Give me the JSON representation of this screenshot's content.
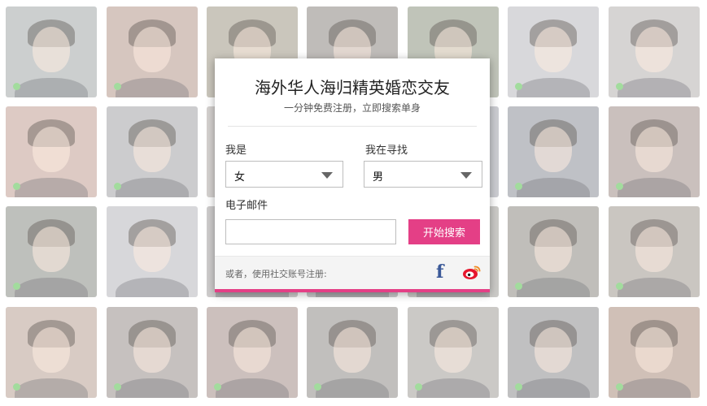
{
  "colors": {
    "accent": "#e43f86",
    "facebook": "#3b5998",
    "weibo": "#e6162d",
    "online_dot": "#7fcf78"
  },
  "gallery": {
    "tile_count": 28,
    "tile_colors": [
      "#b9bdbd",
      "#c7b0a7",
      "#b6b1a3",
      "#a7a39f",
      "#a8ad9e",
      "#c9c9cd",
      "#c7c4c3",
      "#d0b6ad",
      "#b9b9bb",
      "#c4c0bd",
      "#bdb8b3",
      "#b7b9bf",
      "#a7a9b0",
      "#b6a8a4",
      "#a6a8a2",
      "#c8c8cc",
      "#bcb9b9",
      "#b4b4b6",
      "#b8b6b2",
      "#a8a6a0",
      "#b6b0aa",
      "#c9b7ad",
      "#b0a9a7",
      "#b9a8a4",
      "#a9a7a4",
      "#b7b4b1",
      "#a8a8aa",
      "#bea89c"
    ],
    "online_tiles": [
      0,
      1,
      5,
      6,
      7,
      8,
      12,
      13,
      14,
      19,
      20,
      21,
      22,
      23,
      24,
      25,
      26,
      27
    ]
  },
  "modal": {
    "title": "海外华人海归精英婚恋交友",
    "subtitle": "一分钟免费注册，立即搜索单身",
    "i_am_label": "我是",
    "i_am_value": "女",
    "seeking_label": "我在寻找",
    "seeking_value": "男",
    "email_label": "电子邮件",
    "email_value": "",
    "email_placeholder": "",
    "search_button": "开始搜索",
    "social_text": "或者，使用社交账号注册:",
    "facebook_glyph": "f"
  }
}
